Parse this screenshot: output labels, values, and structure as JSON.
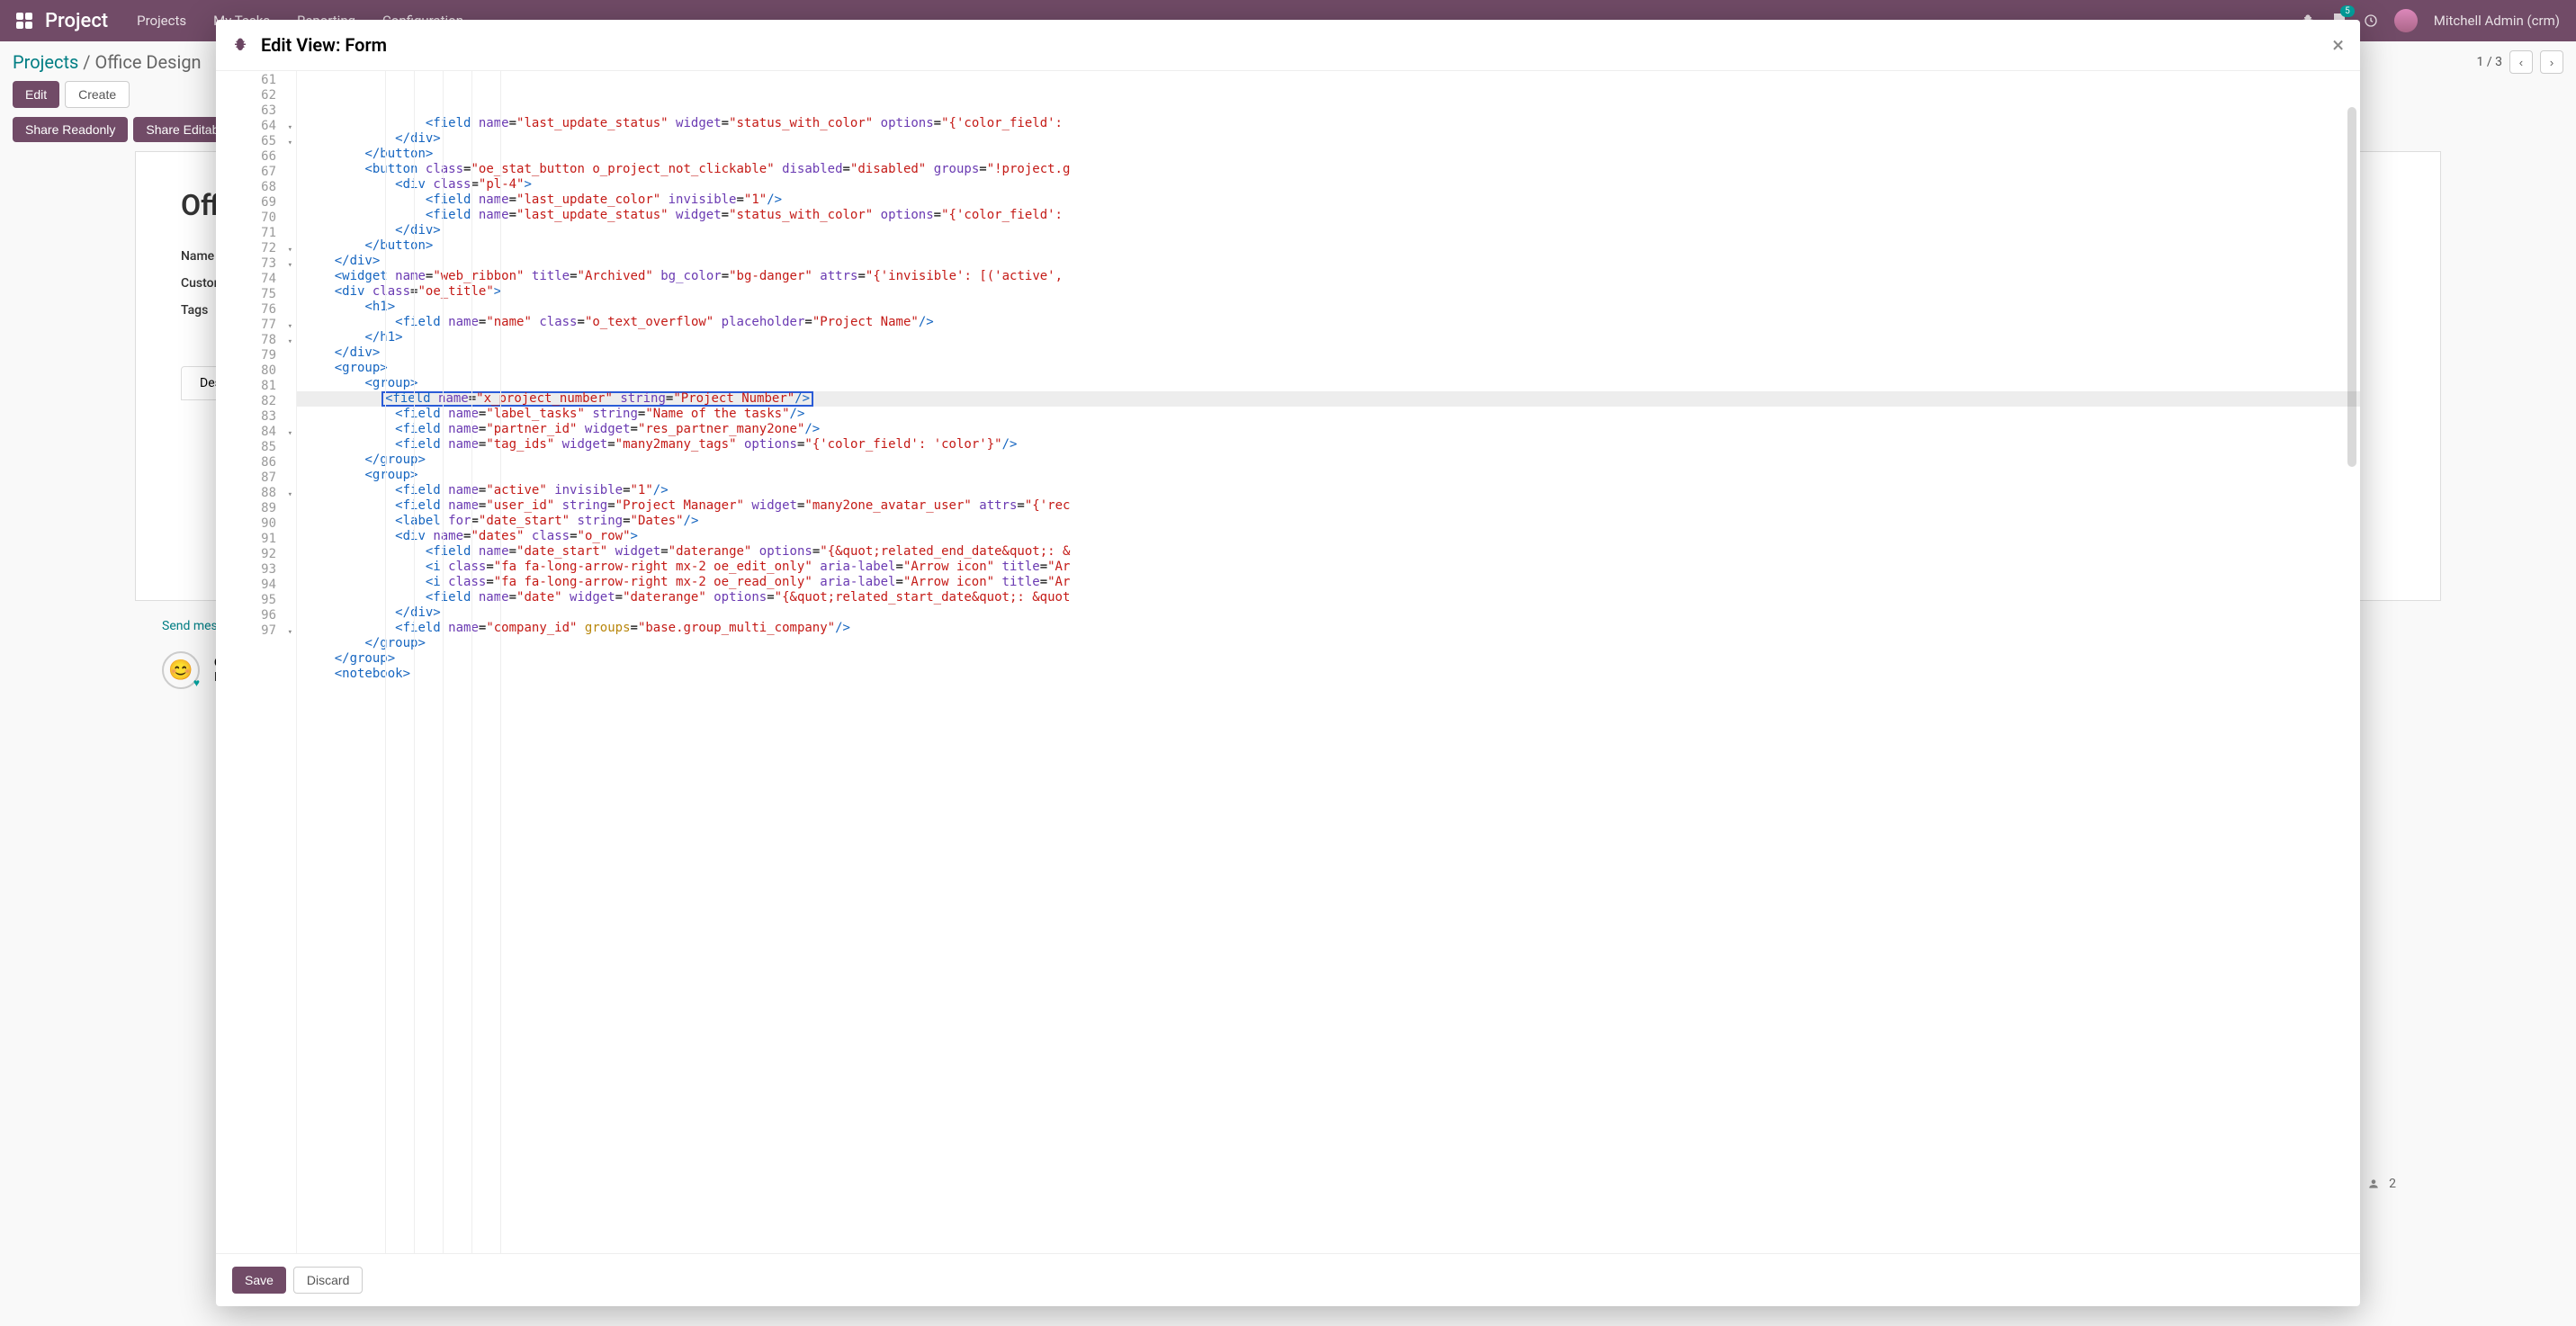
{
  "nav": {
    "brand": "Project",
    "menu": [
      "Projects",
      "My Tasks",
      "Reporting",
      "Configuration"
    ],
    "badge_count": "5",
    "user": "Mitchell Admin (crm)"
  },
  "breadcrumb": {
    "parent": "Projects",
    "sep": " / ",
    "current": "Office Design"
  },
  "pager": {
    "text": "1 / 3"
  },
  "buttons": {
    "edit": "Edit",
    "create": "Create",
    "share_ro": "Share Readonly",
    "share_rw": "Share Editable",
    "save": "Save",
    "discard": "Discard"
  },
  "form": {
    "title": "Office",
    "labels": {
      "name": "Name of",
      "customer": "Custome",
      "tags": "Tags",
      "desc": "Descrip"
    },
    "send_message": "Send mess",
    "odoobot": "Od",
    "proj": "Pro"
  },
  "modal": {
    "title": "Edit View: Form"
  },
  "followers": {
    "count": "2"
  },
  "code_lines": [
    {
      "n": 61,
      "indent": 16,
      "html": "<span class='t-tag'>&lt;field</span> <span class='t-attr'>name</span>=<span class='t-str'>\"last_update_status\"</span> <span class='t-attr'>widget</span>=<span class='t-str'>\"status_with_color\"</span> <span class='t-attr'>options</span>=<span class='t-str'>\"</span><span class='t-json'>{'color_field':</span>"
    },
    {
      "n": 62,
      "indent": 12,
      "html": "<span class='t-tag'>&lt;/div&gt;</span>"
    },
    {
      "n": 63,
      "indent": 8,
      "html": "<span class='t-tag'>&lt;/button&gt;</span>"
    },
    {
      "n": 64,
      "fold": true,
      "indent": 8,
      "html": "<span class='t-tag'>&lt;button</span> <span class='t-attr'>class</span>=<span class='t-str'>\"oe_stat_button o_project_not_clickable\"</span> <span class='t-attr'>disabled</span>=<span class='t-str'>\"disabled\"</span> <span class='t-attr'>groups</span>=<span class='t-str'>\"!project.g</span>"
    },
    {
      "n": 65,
      "fold": true,
      "indent": 12,
      "html": "<span class='t-tag'>&lt;div</span> <span class='t-attr'>class</span>=<span class='t-str'>\"pl-4\"</span><span class='t-tag'>&gt;</span>"
    },
    {
      "n": 66,
      "indent": 16,
      "html": "<span class='t-tag'>&lt;field</span> <span class='t-attr'>name</span>=<span class='t-str'>\"last_update_color\"</span> <span class='t-attr'>invisible</span>=<span class='t-str'>\"1\"</span><span class='t-tag'>/&gt;</span>"
    },
    {
      "n": 67,
      "indent": 16,
      "html": "<span class='t-tag'>&lt;field</span> <span class='t-attr'>name</span>=<span class='t-str'>\"last_update_status\"</span> <span class='t-attr'>widget</span>=<span class='t-str'>\"status_with_color\"</span> <span class='t-attr'>options</span>=<span class='t-str'>\"</span><span class='t-json'>{'color_field':</span>"
    },
    {
      "n": 68,
      "indent": 12,
      "html": "<span class='t-tag'>&lt;/div&gt;</span>"
    },
    {
      "n": 69,
      "indent": 8,
      "html": "<span class='t-tag'>&lt;/button&gt;</span>"
    },
    {
      "n": 70,
      "indent": 4,
      "html": "<span class='t-tag'>&lt;/div&gt;</span>"
    },
    {
      "n": 71,
      "indent": 4,
      "html": "<span class='t-tag'>&lt;widget</span> <span class='t-attr'>name</span>=<span class='t-str'>\"web_ribbon\"</span> <span class='t-attr'>title</span>=<span class='t-str'>\"Archived\"</span> <span class='t-attr'>bg_color</span>=<span class='t-str'>\"bg-danger\"</span> <span class='t-attr'>attrs</span>=<span class='t-str'>\"</span><span class='t-json'>{'invisible': [('active',</span>"
    },
    {
      "n": 72,
      "fold": true,
      "indent": 4,
      "html": "<span class='t-tag'>&lt;div</span> <span class='t-attr'>class</span>=<span class='t-str'>\"oe_title\"</span><span class='t-tag'>&gt;</span>"
    },
    {
      "n": 73,
      "fold": true,
      "indent": 8,
      "html": "<span class='t-tag'>&lt;h1&gt;</span>"
    },
    {
      "n": 74,
      "indent": 12,
      "html": "<span class='t-tag'>&lt;field</span> <span class='t-attr'>name</span>=<span class='t-str'>\"name\"</span> <span class='t-attr'>class</span>=<span class='t-str'>\"o_text_overflow\"</span> <span class='t-attr'>placeholder</span>=<span class='t-str'>\"Project Name\"</span><span class='t-tag'>/&gt;</span>"
    },
    {
      "n": 75,
      "indent": 8,
      "html": "<span class='t-tag'>&lt;/h1&gt;</span>"
    },
    {
      "n": 76,
      "indent": 4,
      "html": "<span class='t-tag'>&lt;/div&gt;</span>"
    },
    {
      "n": 77,
      "fold": true,
      "indent": 4,
      "html": "<span class='t-tag'>&lt;group&gt;</span>"
    },
    {
      "n": 78,
      "fold": true,
      "indent": 8,
      "html": "<span class='t-tag'>&lt;group&gt;</span>"
    },
    {
      "n": 79,
      "hl": true,
      "box": true,
      "indent": 12,
      "html": "<span class='t-tag'>&lt;field</span> <span class='t-attr'>name</span>=<span class='t-str'>\"x_project_number\"</span> <span class='t-attr'>string</span>=<span class='t-str'>\"Project Number\"</span><span class='t-tag'>/&gt;</span>"
    },
    {
      "n": 80,
      "indent": 12,
      "html": "<span class='t-tag'>&lt;field</span> <span class='t-attr'>name</span>=<span class='t-str'>\"label_tasks\"</span> <span class='t-attr'>string</span>=<span class='t-str'>\"Name of the tasks\"</span><span class='t-tag'>/&gt;</span>"
    },
    {
      "n": 81,
      "indent": 12,
      "html": "<span class='t-tag'>&lt;field</span> <span class='t-attr'>name</span>=<span class='t-str'>\"partner_id\"</span> <span class='t-attr'>widget</span>=<span class='t-str'>\"res_partner_many2one\"</span><span class='t-tag'>/&gt;</span>"
    },
    {
      "n": 82,
      "indent": 12,
      "html": "<span class='t-tag'>&lt;field</span> <span class='t-attr'>name</span>=<span class='t-str'>\"tag_ids\"</span> <span class='t-attr'>widget</span>=<span class='t-str'>\"many2many_tags\"</span> <span class='t-attr'>options</span>=<span class='t-str'>\"</span><span class='t-json'>{'color_field': 'color'}</span><span class='t-str'>\"</span><span class='t-tag'>/&gt;</span>"
    },
    {
      "n": 83,
      "indent": 8,
      "html": "<span class='t-tag'>&lt;/group&gt;</span>"
    },
    {
      "n": 84,
      "fold": true,
      "indent": 8,
      "html": "<span class='t-tag'>&lt;group&gt;</span>"
    },
    {
      "n": 85,
      "indent": 12,
      "html": "<span class='t-tag'>&lt;field</span> <span class='t-attr'>name</span>=<span class='t-str'>\"active\"</span> <span class='t-attr'>invisible</span>=<span class='t-str'>\"1\"</span><span class='t-tag'>/&gt;</span>"
    },
    {
      "n": 86,
      "indent": 12,
      "html": "<span class='t-tag'>&lt;field</span> <span class='t-attr'>name</span>=<span class='t-str'>\"user_id\"</span> <span class='t-attr'>string</span>=<span class='t-str'>\"Project Manager\"</span> <span class='t-attr'>widget</span>=<span class='t-str'>\"many2one_avatar_user\"</span> <span class='t-attr'>attrs</span>=<span class='t-str'>\"</span><span class='t-json'>{'rec</span>"
    },
    {
      "n": 87,
      "indent": 12,
      "html": "<span class='t-tag'>&lt;label</span> <span class='t-attr'>for</span>=<span class='t-str'>\"date_start\"</span> <span class='t-attr'>string</span>=<span class='t-str'>\"Dates\"</span><span class='t-tag'>/&gt;</span>"
    },
    {
      "n": 88,
      "fold": true,
      "indent": 12,
      "html": "<span class='t-tag'>&lt;div</span> <span class='t-attr'>name</span>=<span class='t-str'>\"dates\"</span> <span class='t-attr'>class</span>=<span class='t-str'>\"o_row\"</span><span class='t-tag'>&gt;</span>"
    },
    {
      "n": 89,
      "indent": 16,
      "html": "<span class='t-tag'>&lt;field</span> <span class='t-attr'>name</span>=<span class='t-str'>\"date_start\"</span> <span class='t-attr'>widget</span>=<span class='t-str'>\"daterange\"</span> <span class='t-attr'>options</span>=<span class='t-str'>\"</span><span class='t-json'>{&amp;quot;related_end_date&amp;quot;: &amp;</span>"
    },
    {
      "n": 90,
      "indent": 16,
      "html": "<span class='t-tag'>&lt;i</span> <span class='t-attr'>class</span>=<span class='t-str'>\"fa fa-long-arrow-right mx-2 oe_edit_only\"</span> <span class='t-attr'>aria-label</span>=<span class='t-str'>\"Arrow icon\"</span> <span class='t-attr'>title</span>=<span class='t-str'>\"Ar</span>"
    },
    {
      "n": 91,
      "indent": 16,
      "html": "<span class='t-tag'>&lt;i</span> <span class='t-attr'>class</span>=<span class='t-str'>\"fa fa-long-arrow-right mx-2 oe_read_only\"</span> <span class='t-attr'>aria-label</span>=<span class='t-str'>\"Arrow icon\"</span> <span class='t-attr'>title</span>=<span class='t-str'>\"Ar</span>"
    },
    {
      "n": 92,
      "indent": 16,
      "html": "<span class='t-tag'>&lt;field</span> <span class='t-attr'>name</span>=<span class='t-str'>\"date\"</span> <span class='t-attr'>widget</span>=<span class='t-str'>\"daterange\"</span> <span class='t-attr'>options</span>=<span class='t-str'>\"</span><span class='t-json'>{&amp;quot;related_start_date&amp;quot;: &amp;quot</span>"
    },
    {
      "n": 93,
      "indent": 12,
      "html": "<span class='t-tag'>&lt;/div&gt;</span>"
    },
    {
      "n": 94,
      "indent": 12,
      "html": "<span class='t-tag'>&lt;field</span> <span class='t-attr'>name</span>=<span class='t-str'>\"company_id\"</span> <span class='t-spec'>groups</span>=<span class='t-str'>\"base.group_multi_company\"</span><span class='t-tag'>/&gt;</span>"
    },
    {
      "n": 95,
      "indent": 8,
      "html": "<span class='t-tag'>&lt;/group&gt;</span>"
    },
    {
      "n": 96,
      "indent": 4,
      "html": "<span class='t-tag'>&lt;/group&gt;</span>"
    },
    {
      "n": 97,
      "fold": true,
      "indent": 4,
      "html": "<span class='t-tag'>&lt;notebook&gt;</span>"
    }
  ]
}
